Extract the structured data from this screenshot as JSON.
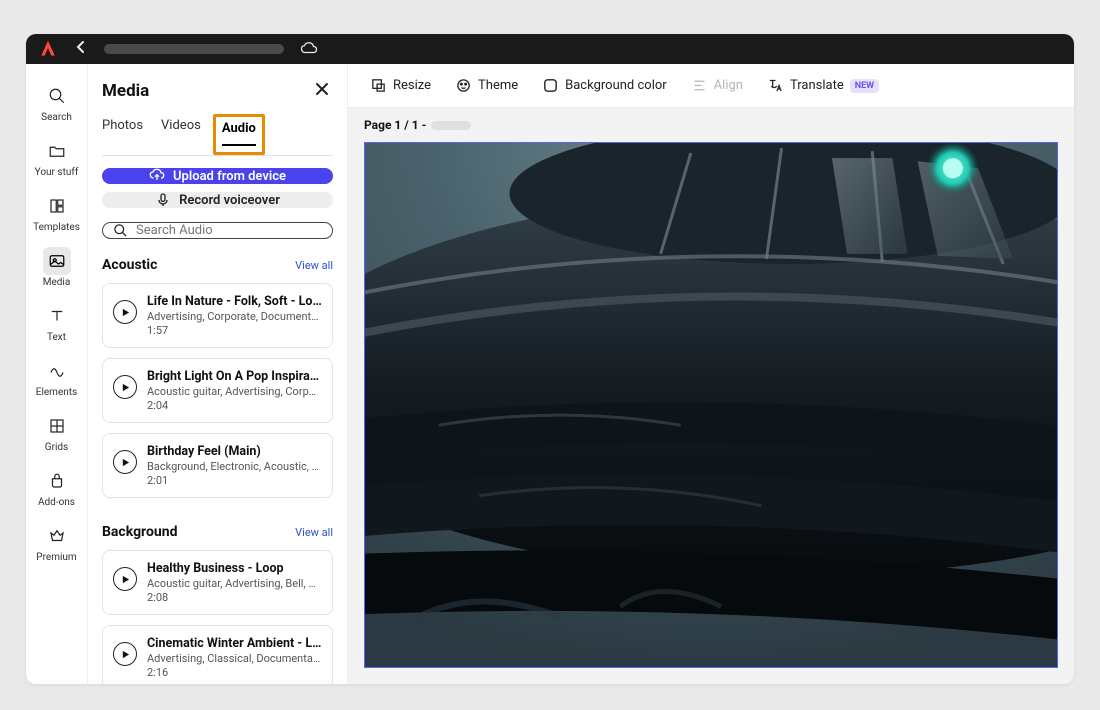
{
  "rail": {
    "items": [
      {
        "label": "Search",
        "name": "rail-search"
      },
      {
        "label": "Your stuff",
        "name": "rail-your-stuff"
      },
      {
        "label": "Templates",
        "name": "rail-templates"
      },
      {
        "label": "Media",
        "name": "rail-media"
      },
      {
        "label": "Text",
        "name": "rail-text"
      },
      {
        "label": "Elements",
        "name": "rail-elements"
      },
      {
        "label": "Grids",
        "name": "rail-grids"
      },
      {
        "label": "Add-ons",
        "name": "rail-addons"
      },
      {
        "label": "Premium",
        "name": "rail-premium"
      }
    ]
  },
  "panel": {
    "title": "Media",
    "tabs": {
      "photos": "Photos",
      "videos": "Videos",
      "audio": "Audio"
    },
    "upload_label": "Upload from device",
    "record_label": "Record voiceover",
    "search_placeholder": "Search Audio",
    "view_all": "View all",
    "sections": [
      {
        "title": "Acoustic",
        "tracks": [
          {
            "title": "Life In Nature - Folk, Soft - Loop",
            "tags": "Advertising, Corporate, Documentary, D…",
            "duration": "1:57"
          },
          {
            "title": "Bright Light On A Pop Inspiratio…",
            "tags": "Acoustic guitar, Advertising, Corporate, …",
            "duration": "2:04"
          },
          {
            "title": "Birthday Feel (Main)",
            "tags": "Background, Electronic, Acoustic, Folk, …",
            "duration": "2:01"
          }
        ]
      },
      {
        "title": "Background",
        "tracks": [
          {
            "title": "Healthy Business - Loop",
            "tags": "Acoustic guitar, Advertising, Bell, Corpor…",
            "duration": "2:08"
          },
          {
            "title": "Cinematic Winter Ambient - Loop",
            "tags": "Advertising, Classical, Documentary, Dr…",
            "duration": "2:16"
          }
        ]
      }
    ]
  },
  "toolbar": {
    "resize": "Resize",
    "theme": "Theme",
    "bg": "Background color",
    "align": "Align",
    "translate": "Translate",
    "new_badge": "NEW"
  },
  "page": {
    "label": "Page 1 / 1 -"
  }
}
